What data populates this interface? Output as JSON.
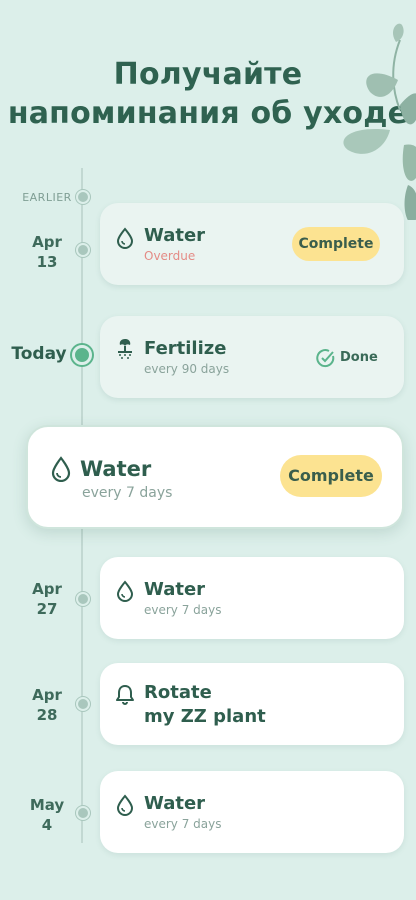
{
  "header": {
    "title_line1": "Получайте",
    "title_line2": "напоминания об уходе"
  },
  "timeline": {
    "earlier_label": "EARLIER",
    "today_label": "Today",
    "dates": [
      {
        "month": "Apr",
        "day": "13"
      },
      {
        "month": "Apr",
        "day": "27"
      },
      {
        "month": "Apr",
        "day": "28"
      },
      {
        "month": "May",
        "day": "4"
      }
    ]
  },
  "cards": [
    {
      "icon": "water-drop-icon",
      "title": "Water",
      "subtitle": "Overdue",
      "action": "Complete"
    },
    {
      "icon": "fertilize-icon",
      "title": "Fertilize",
      "subtitle": "every 90 days",
      "status": "Done"
    },
    {
      "icon": "water-drop-icon",
      "title": "Water",
      "subtitle": "every 7 days",
      "action": "Complete"
    },
    {
      "icon": "water-drop-icon",
      "title": "Water",
      "subtitle": "every 7 days"
    },
    {
      "icon": "bell-icon",
      "title_line1": "Rotate",
      "title_line2": "my ZZ plant"
    },
    {
      "icon": "water-drop-icon",
      "title": "Water",
      "subtitle": "every 7 days"
    }
  ],
  "colors": {
    "background": "#dcefea",
    "title": "#2f6250",
    "button": "#fce391",
    "overdue": "#e48b86",
    "today_dot": "#5bb48c"
  }
}
